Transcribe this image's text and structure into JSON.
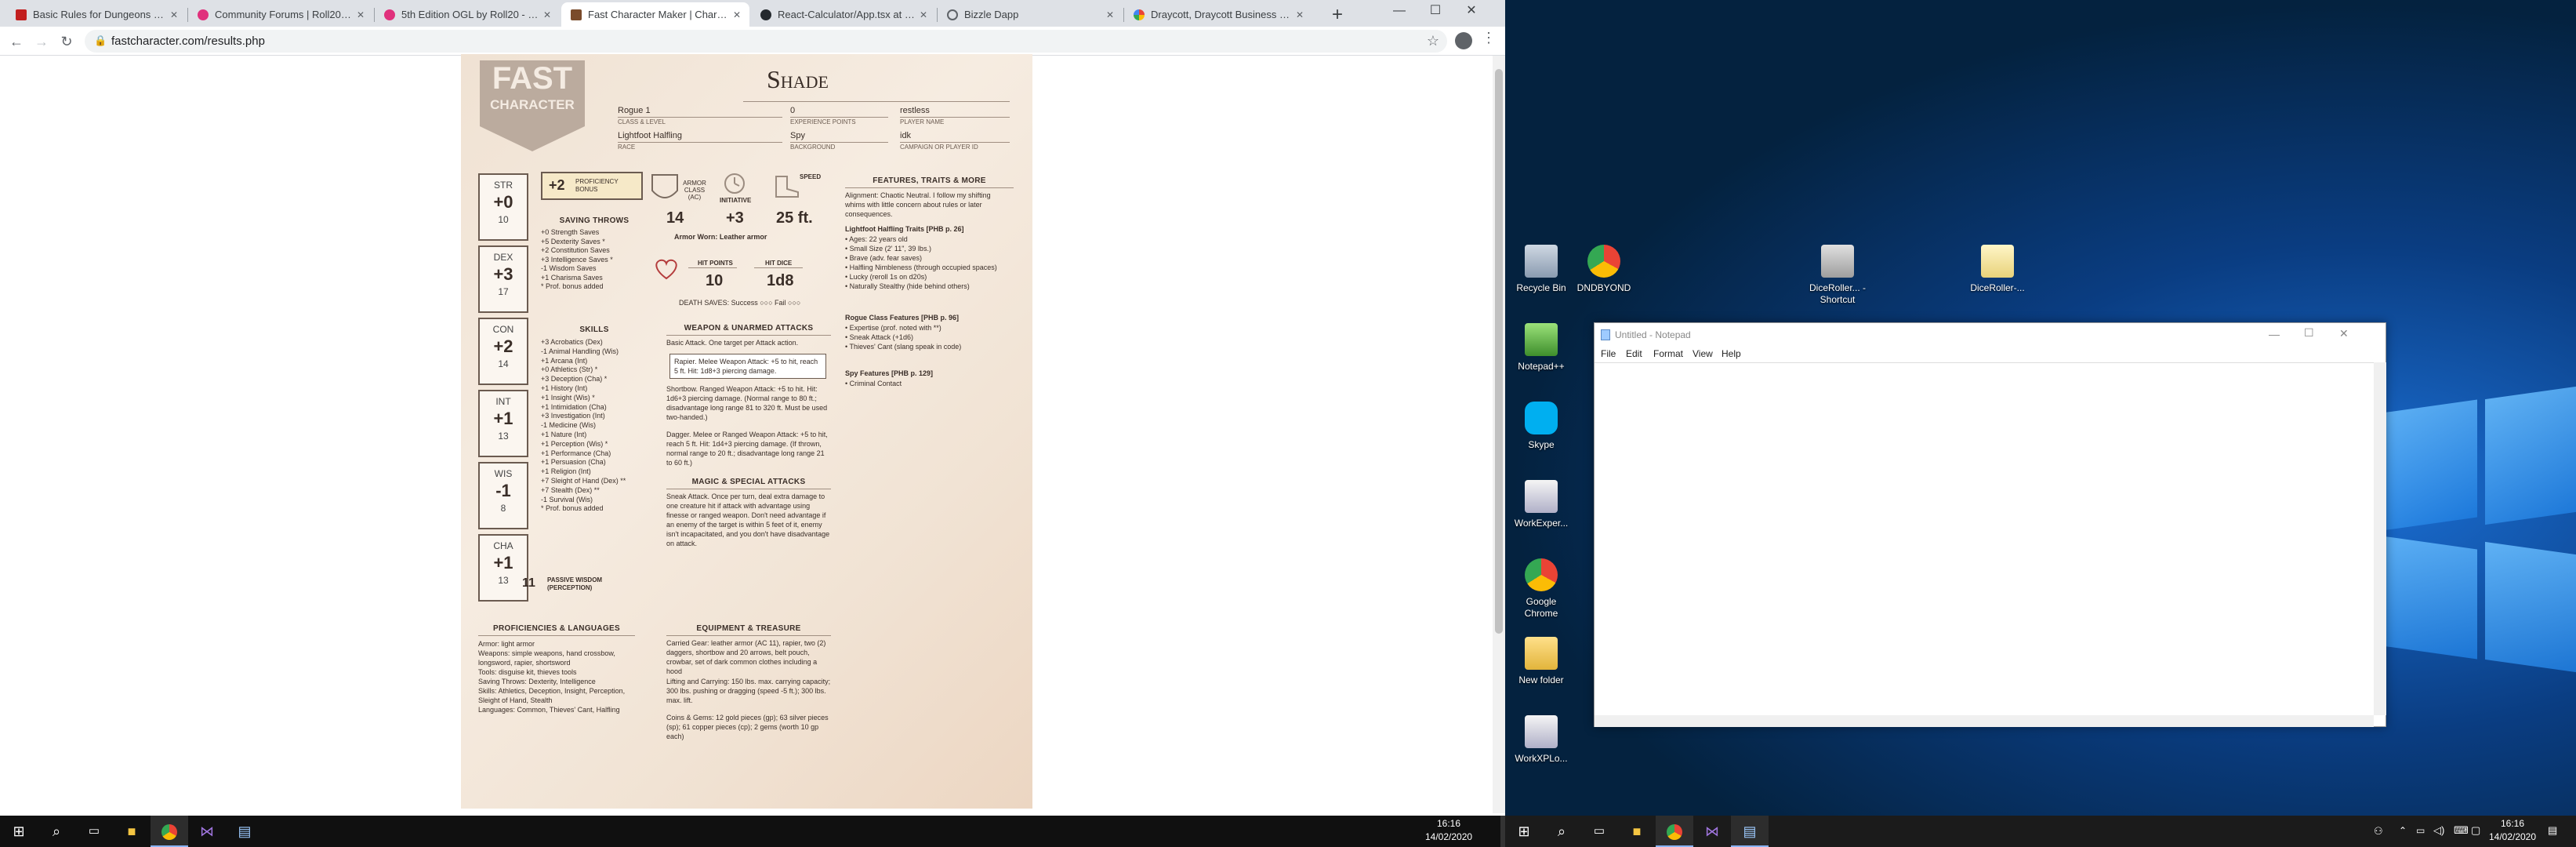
{
  "browser": {
    "tabs": [
      {
        "title": "Basic Rules for Dungeons and D...",
        "favicon_color": "#c21f1f",
        "active": false
      },
      {
        "title": "Community Forums | Roll20: Onl...",
        "favicon_color": "#e0317c",
        "active": false
      },
      {
        "title": "5th Edition OGL by Roll20 - Roll...",
        "favicon_color": "#e0317c",
        "active": false
      },
      {
        "title": "Fast Character Maker | Characte...",
        "favicon_color": "#7a4b2b",
        "active": true
      },
      {
        "title": "React-Calculator/App.tsx at mast...",
        "favicon_color": "#24292e",
        "active": false
      },
      {
        "title": "Bizzle Dapp",
        "favicon_color": "#5f6368",
        "active": false
      },
      {
        "title": "Draycott, Draycott Business Park...",
        "favicon_color": "#34a853",
        "active": false
      }
    ],
    "new_tab": "+",
    "url": "fastcharacter.com/results.php",
    "controls": {
      "minimize": "—",
      "maximize": "☐",
      "close": "✕"
    }
  },
  "sheet": {
    "logo_top": "FAST",
    "logo_bottom": "CHARACTER",
    "name": "Shade",
    "class_level": "Rogue 1",
    "class_level_label": "CLASS & LEVEL",
    "xp": "0",
    "xp_label": "EXPERIENCE POINTS",
    "player": "restless",
    "player_label": "PLAYER NAME",
    "race": "Lightfoot Halfling",
    "race_label": "RACE",
    "background": "Spy",
    "background_label": "BACKGROUND",
    "campaign": "idk",
    "campaign_label": "CAMPAIGN or PLAYER ID",
    "abilities": [
      {
        "name": "STR",
        "mod": "+0",
        "score": "10"
      },
      {
        "name": "DEX",
        "mod": "+3",
        "score": "17"
      },
      {
        "name": "CON",
        "mod": "+2",
        "score": "14"
      },
      {
        "name": "INT",
        "mod": "+1",
        "score": "13"
      },
      {
        "name": "WIS",
        "mod": "-1",
        "score": "8"
      },
      {
        "name": "CHA",
        "mod": "+1",
        "score": "13"
      }
    ],
    "proficiency": {
      "value": "+2",
      "label": "PROFICIENCY BONUS"
    },
    "saving_throws": {
      "title": "SAVING THROWS",
      "items": [
        "+0 Strength Saves",
        "+5 Dexterity Saves *",
        "+2 Constitution Saves",
        "+3 Intelligence Saves *",
        "-1 Wisdom Saves",
        "+1 Charisma Saves",
        "* Prof. bonus added"
      ]
    },
    "skills": {
      "title": "SKILLS",
      "items": [
        "+3  Acrobatics (Dex)",
        "-1  Animal Handling (Wis)",
        "+1  Arcana (Int)",
        "+0  Athletics (Str) *",
        "+3  Deception (Cha) *",
        "+1  History (Int)",
        "+1  Insight (Wis) *",
        "+1  Intimidation (Cha)",
        "+3  Investigation (Int)",
        "-1  Medicine (Wis)",
        "+1  Nature (Int)",
        "+1  Perception (Wis) *",
        "+1  Performance (Cha)",
        "+1  Persuasion (Cha)",
        "+1  Religion (Int)",
        "+7  Sleight of Hand (Dex) **",
        "+7  Stealth (Dex) **",
        "-1  Survival (Wis)",
        "* Prof. bonus added"
      ]
    },
    "passive": {
      "value": "11",
      "label": "PASSIVE WISDOM (PERCEPTION)"
    },
    "armor_class": {
      "value": "14",
      "label": "ARMOR CLASS (AC)"
    },
    "initiative": {
      "value": "+3",
      "label": "INITIATIVE"
    },
    "speed": {
      "value": "25 ft.",
      "label": "SPEED"
    },
    "armor_worn": "Armor Worn: Leather armor",
    "hit_points": {
      "value": "10",
      "label": "HIT POINTS"
    },
    "hit_dice": {
      "value": "1d8",
      "label": "HIT DICE"
    },
    "death_saves": "DEATH SAVES: Success ○○○  Fail ○○○",
    "attacks": {
      "title": "WEAPON & UNARMED ATTACKS",
      "basic": "Basic Attack. One target per Attack action.",
      "rapier": "Rapier. Melee Weapon Attack: +5 to hit, reach 5 ft. Hit: 1d8+3 piercing damage.",
      "shortbow": "Shortbow. Ranged Weapon Attack: +5 to hit. Hit: 1d6+3 piercing damage. (Normal range to 80 ft.; disadvantage long range 81 to 320 ft. Must be used two-handed.)",
      "dagger": "Dagger. Melee or Ranged Weapon Attack: +5 to hit, reach 5 ft. Hit: 1d4+3 piercing damage. (If thrown, normal range to 20 ft.; disadvantage long range 21 to 60 ft.)"
    },
    "magic": {
      "title": "MAGIC & SPECIAL ATTACKS",
      "text": "Sneak Attack. Once per turn, deal extra damage to one creature hit if attack with advantage using finesse or ranged weapon. Don't need advantage if an enemy of the target is within 5 feet of it, enemy isn't incapacitated, and you don't have disadvantage on attack."
    },
    "features": {
      "title": "FEATURES, TRAITS & MORE",
      "alignment": "Alignment: Chaotic Neutral. I follow my shifting whims with little concern about rules or later consequences.",
      "halfling_title": "Lightfoot Halfling Traits [PHB p. 26]",
      "halfling": [
        "• Ages: 22 years old",
        "• Small Size (2' 11\", 39 lbs.)",
        "• Brave (adv. fear saves)",
        "• Halfling Nimbleness (through occupied spaces)",
        "• Lucky (reroll 1s on d20s)",
        "• Naturally Stealthy (hide behind others)"
      ],
      "rogue_title": "Rogue Class Features [PHB p. 96]",
      "rogue": [
        "• Expertise (prof. noted with **)",
        "• Sneak Attack (+1d6)",
        "• Thieves' Cant (slang speak in code)"
      ],
      "spy_title": "Spy Features [PHB p. 129]",
      "spy": [
        "• Criminal Contact"
      ]
    },
    "proficiencies": {
      "title": "PROFICIENCIES & LANGUAGES",
      "items": [
        "Armor: light armor",
        "Weapons: simple weapons, hand crossbow, longsword, rapier, shortsword",
        "Tools: disguise kit, thieves tools",
        "Saving Throws: Dexterity, Intelligence",
        "Skills: Athletics, Deception, Insight, Perception, Sleight of Hand, Stealth",
        "Languages: Common, Thieves' Cant, Halfling"
      ]
    },
    "equipment": {
      "title": "EQUIPMENT & TREASURE",
      "carried": "Carried Gear: leather armor (AC 11), rapier, two (2) daggers, shortbow and 20 arrows, belt pouch, crowbar, set of dark common clothes including a hood",
      "lifting": "Lifting and Carrying: 150 lbs. max. carrying capacity; 300 lbs. pushing or dragging (speed -5 ft.); 300 lbs. max. lift.",
      "coins": "Coins & Gems: 12 gold pieces (gp); 63 silver pieces (sp); 61 copper pieces (cp); 2 gems (worth 10 gp each)"
    }
  },
  "taskbar_left": {
    "time": "16:16",
    "date": "14/02/2020"
  },
  "desktop": {
    "icons": [
      {
        "label": "Recycle Bin"
      },
      {
        "label": "DNDBYOND"
      },
      {
        "label": "DiceRoller... - Shortcut"
      },
      {
        "label": "DiceRoller-..."
      },
      {
        "label": "Notepad++"
      },
      {
        "label": "Skype"
      },
      {
        "label": "WorkExper..."
      },
      {
        "label": "Google Chrome"
      },
      {
        "label": "New folder"
      },
      {
        "label": "WorkXPLo..."
      }
    ],
    "notepad": {
      "title": "Untitled - Notepad",
      "menu": [
        "File",
        "Edit",
        "Format",
        "View",
        "Help"
      ]
    }
  },
  "taskbar_right": {
    "time": "16:16",
    "date": "14/02/2020"
  }
}
